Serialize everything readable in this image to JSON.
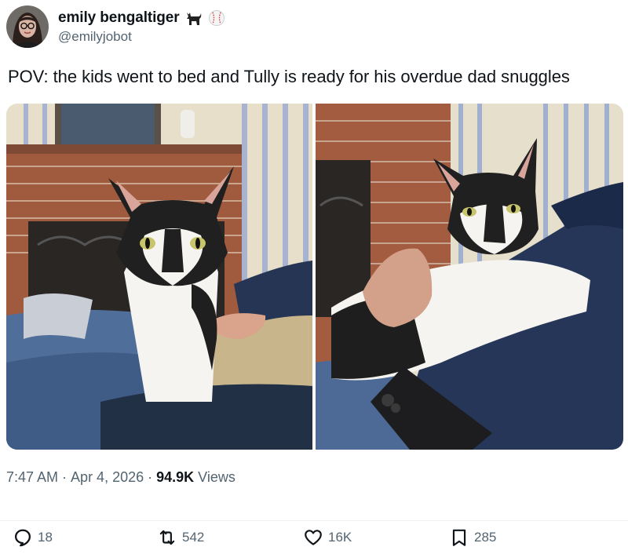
{
  "author": {
    "display_name": "emily bengaltiger",
    "handle": "@emilyjobot",
    "badges": [
      "black-cat-emoji",
      "baseball-emoji"
    ]
  },
  "tweet": {
    "text": "POV: the kids went to bed and Tully is ready for his overdue dad snuggles",
    "media_count": 2
  },
  "meta": {
    "time": "7:47 AM",
    "date": "Apr 4, 2026",
    "separator": "·",
    "views_count": "94.9K",
    "views_label": "Views"
  },
  "actions": {
    "replies": "18",
    "reposts": "542",
    "likes": "16K",
    "bookmarks": "285"
  },
  "colors": {
    "text": "#0f1419",
    "secondary": "#536471",
    "divider": "#eff3f4"
  }
}
